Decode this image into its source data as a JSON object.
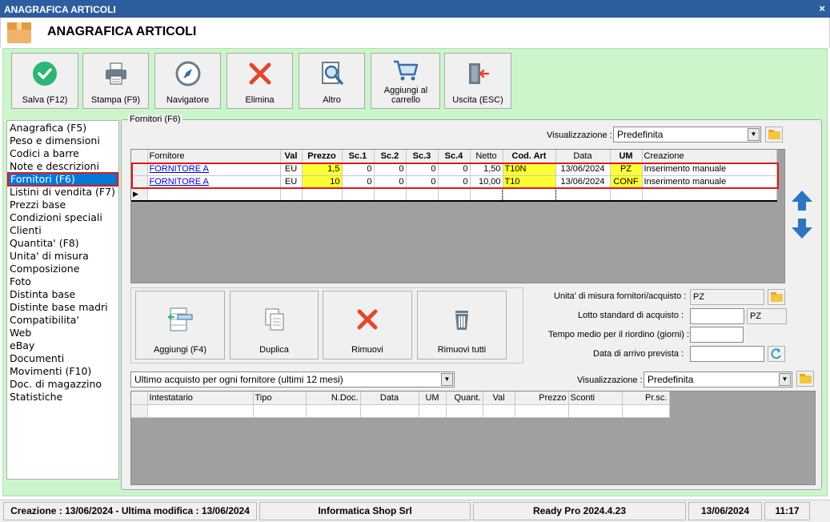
{
  "window": {
    "title": "ANAGRAFICA ARTICOLI",
    "close_glyph": "×"
  },
  "header": {
    "title": "ANAGRAFICA ARTICOLI",
    "icon": "package-box-icon"
  },
  "toolbar": {
    "save": "Salva (F12)",
    "print": "Stampa (F9)",
    "navigator": "Navigatore",
    "delete": "Elimina",
    "other": "Altro",
    "add_to_cart": "Aggiungi al carrello",
    "exit": "Uscita (ESC)"
  },
  "menu": [
    "Anagrafica (F5)",
    "Peso e dimensioni",
    "Codici a barre",
    "Note e descrizioni",
    "Fornitori (F6)",
    "Listini di vendita (F7)",
    "Prezzi base",
    "Condizioni speciali",
    "Clienti",
    "Quantita' (F8)",
    "Unita' di misura",
    "Composizione",
    "Foto",
    "Distinta base",
    "Distinte base madri",
    "Compatibilita'",
    "Web",
    "eBay",
    "Documenti",
    "Movimenti (F10)",
    "Doc. di magazzino",
    "Statistiche"
  ],
  "menu_selected_index": 4,
  "suppliers": {
    "group_label": "Fornitori (F6)",
    "view_label": "Visualizzazione :",
    "view_value": "Predefinita",
    "columns": [
      "Fornitore",
      "Val",
      "Prezzo",
      "Sc.1",
      "Sc.2",
      "Sc.3",
      "Sc.4",
      "Netto",
      "Cod. Art",
      "Data",
      "UM",
      "Creazione"
    ],
    "rows": [
      [
        "FORNITORE A",
        "EU",
        "1,5",
        "0",
        "0",
        "0",
        "0",
        "1,50",
        "T10N",
        "13/06/2024",
        "PZ",
        "Inserimento manuale"
      ],
      [
        "FORNITORE A",
        "EU",
        "10",
        "0",
        "0",
        "0",
        "0",
        "10,00",
        "T10",
        "13/06/2024",
        "CONF",
        "Inserimento manuale"
      ]
    ],
    "highlight_color": "#ffff33",
    "selection_border_color": "#e01818"
  },
  "actions": {
    "add": "Aggiungi (F4)",
    "duplicate": "Duplica",
    "remove": "Rimuovi",
    "remove_all": "Rimuovi tutti"
  },
  "fields": {
    "um_label": "Unita' di misura fornitori/acquisto :",
    "um_value": "PZ",
    "lotto_label": "Lotto standard di acquisto :",
    "lotto_value": "",
    "lotto_unit": "PZ",
    "tempo_label": "Tempo medio per il riordino (giorni) :",
    "tempo_value": "",
    "data_label": "Data di arrivo prevista :",
    "data_value": ""
  },
  "purchases": {
    "filter_value": "Ultimo acquisto per ogni fornitore (ultimi 12 mesi)",
    "view_label": "Visualizzazione :",
    "view_value": "Predefinita",
    "columns": [
      "Intestatario",
      "Tipo",
      "N.Doc.",
      "Data",
      "UM",
      "Quant.",
      "Val",
      "Prezzo",
      "Sconti",
      "Pr.sc."
    ]
  },
  "status": {
    "dates": "Creazione : 13/06/2024 - Ultima modifica : 13/06/2024",
    "company": "Informatica Shop Srl",
    "version": "Ready Pro 2024.4.23",
    "date": "13/06/2024",
    "time": "11:17"
  }
}
